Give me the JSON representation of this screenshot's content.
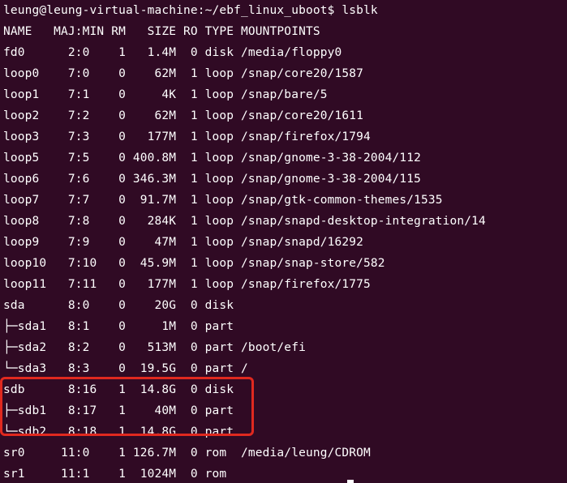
{
  "terminal": {
    "prompt": "leung@leung-virtual-machine:~/ebf_linux_uboot$ lsblk",
    "header": "NAME   MAJ:MIN RM   SIZE RO TYPE MOUNTPOINTS",
    "rows": [
      "fd0      2:0    1   1.4M  0 disk /media/floppy0",
      "loop0    7:0    0    62M  1 loop /snap/core20/1587",
      "loop1    7:1    0     4K  1 loop /snap/bare/5",
      "loop2    7:2    0    62M  1 loop /snap/core20/1611",
      "loop3    7:3    0   177M  1 loop /snap/firefox/1794",
      "loop5    7:5    0 400.8M  1 loop /snap/gnome-3-38-2004/112",
      "loop6    7:6    0 346.3M  1 loop /snap/gnome-3-38-2004/115",
      "loop7    7:7    0  91.7M  1 loop /snap/gtk-common-themes/1535",
      "loop8    7:8    0   284K  1 loop /snap/snapd-desktop-integration/14",
      "loop9    7:9    0    47M  1 loop /snap/snapd/16292",
      "loop10   7:10   0  45.9M  1 loop /snap/snap-store/582",
      "loop11   7:11   0   177M  1 loop /snap/firefox/1775",
      "sda      8:0    0    20G  0 disk",
      "├─sda1   8:1    0     1M  0 part",
      "├─sda2   8:2    0   513M  0 part /boot/efi",
      "└─sda3   8:3    0  19.5G  0 part /",
      "sdb      8:16   1  14.8G  0 disk",
      "├─sdb1   8:17   1    40M  0 part",
      "└─sdb2   8:18   1  14.8G  0 part",
      "sr0     11:0    1 126.7M  0 rom  /media/leung/CDROM",
      "sr1     11:1    1  1024M  0 rom"
    ],
    "highlight_color": "#e0291f",
    "background_color": "#300a24"
  }
}
